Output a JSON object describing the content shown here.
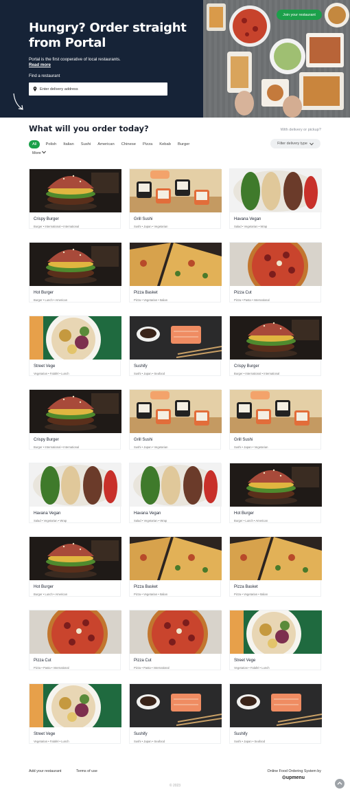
{
  "hero": {
    "title": "Hungry? Order straight from Portal",
    "subtitle": "Portal is the first cooperative of local restaurants.",
    "read_more": "Read more",
    "find_label": "Find a restaurant",
    "address_placeholder": "Enter delivery address",
    "join_button": "Join your restaurant"
  },
  "main": {
    "title": "What will you order today?",
    "delivery_question": "With delivery or pickup?",
    "filter_button": "Filter delivery type",
    "more_label": "More",
    "filters": [
      "All",
      "Polish",
      "Italian",
      "Sushi",
      "American",
      "Chinese",
      "Pizza",
      "Kebab",
      "Burger"
    ]
  },
  "restaurants": [
    {
      "name": "Crispy Burger",
      "tags": "Burger • International • International",
      "photo": "burger-photo"
    },
    {
      "name": "Grill Sushi",
      "tags": "Sushi • Japan • Vegetarian",
      "photo": "sushi-photo"
    },
    {
      "name": "Havana Vegan",
      "tags": "Salad • Vegetarian • Wrap",
      "photo": "vegan-photo"
    },
    {
      "name": "Hot Burger",
      "tags": "Burger • Lunch • American",
      "photo": "burger-photo"
    },
    {
      "name": "Pizza Basket",
      "tags": "Pizza • Vegetarian • Italian",
      "photo": "pizza-slices-photo"
    },
    {
      "name": "Pizza Cut",
      "tags": "Pizza • Pasta • International",
      "photo": "pizza-photo"
    },
    {
      "name": "Street Vege",
      "tags": "Vegetarian • Falafel • Lunch",
      "photo": "bowl-photo"
    },
    {
      "name": "Sushify",
      "tags": "Sushi • Japan • Seafood",
      "photo": "salmon-photo"
    },
    {
      "name": "Crispy Burger",
      "tags": "Burger • International • International",
      "photo": "burger-photo"
    },
    {
      "name": "Crispy Burger",
      "tags": "Burger • International • International",
      "photo": "burger-photo"
    },
    {
      "name": "Grill Sushi",
      "tags": "Sushi • Japan • Vegetarian",
      "photo": "sushi-photo"
    },
    {
      "name": "Grill Sushi",
      "tags": "Sushi • Japan • Vegetarian",
      "photo": "sushi-photo"
    },
    {
      "name": "Havana Vegan",
      "tags": "Salad • Vegetarian • Wrap",
      "photo": "vegan-photo"
    },
    {
      "name": "Havana Vegan",
      "tags": "Salad • Vegetarian • Wrap",
      "photo": "vegan-photo"
    },
    {
      "name": "Hot Burger",
      "tags": "Burger • Lunch • American",
      "photo": "burger-photo"
    },
    {
      "name": "Hot Burger",
      "tags": "Burger • Lunch • American",
      "photo": "burger-photo"
    },
    {
      "name": "Pizza Basket",
      "tags": "Pizza • Vegetarian • Italian",
      "photo": "pizza-slices-photo"
    },
    {
      "name": "Pizza Basket",
      "tags": "Pizza • Vegetarian • Italian",
      "photo": "pizza-slices-photo"
    },
    {
      "name": "Pizza Cut",
      "tags": "Pizza • Pasta • International",
      "photo": "pizza-photo"
    },
    {
      "name": "Pizza Cut",
      "tags": "Pizza • Pasta • International",
      "photo": "pizza-photo"
    },
    {
      "name": "Street Vege",
      "tags": "Vegetarian • Falafel • Lunch",
      "photo": "bowl-photo"
    },
    {
      "name": "Street Vege",
      "tags": "Vegetarian • Falafel • Lunch",
      "photo": "bowl-photo"
    },
    {
      "name": "Sushify",
      "tags": "Sushi • Japan • Seafood",
      "photo": "salmon-photo"
    },
    {
      "name": "Sushify",
      "tags": "Sushi • Japan • Seafood",
      "photo": "salmon-photo"
    }
  ],
  "footer": {
    "add_restaurant": "Add your restaurant",
    "terms": "Terms of use",
    "powered_by": "Online Food Ordering System by",
    "brand": "upmenu",
    "copyright": "© 2023"
  },
  "colors": {
    "primary": "#1ba04a",
    "hero_bg": "#162337"
  },
  "icons": [
    "location-pin-icon",
    "chevron-down-icon",
    "arrow-doodle-icon",
    "scroll-top-icon"
  ]
}
